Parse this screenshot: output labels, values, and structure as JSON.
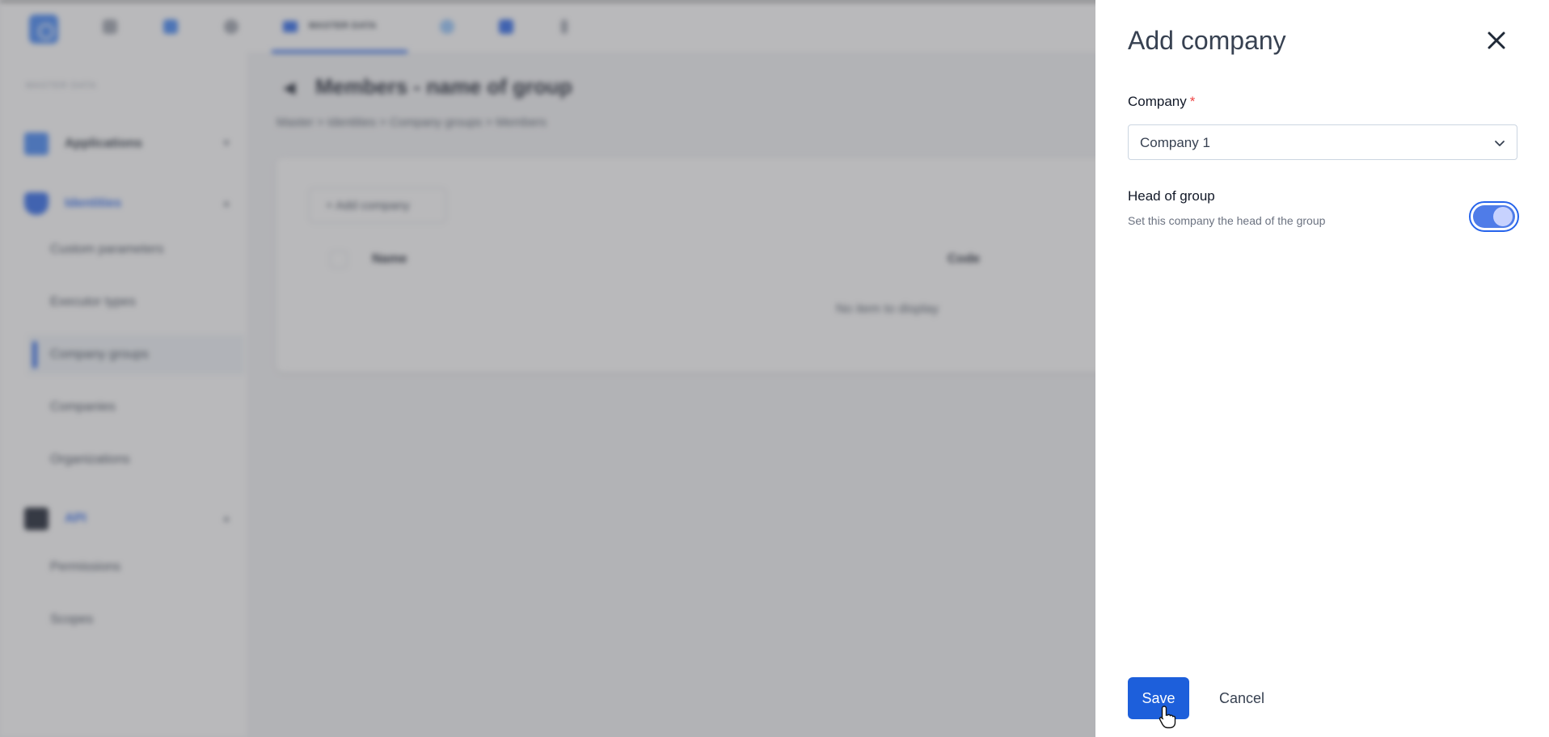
{
  "background": {
    "nav": {
      "active_tab_label": "MASTER DATA"
    },
    "sidebar": {
      "section_label": "MASTER DATA",
      "groups": [
        {
          "label": "Applications",
          "icon": "applications-icon"
        },
        {
          "label": "Identities",
          "icon": "shield-icon"
        },
        {
          "label": "API",
          "icon": "terminal-icon"
        }
      ],
      "items": [
        {
          "label": "Custom parameters"
        },
        {
          "label": "Executor types"
        },
        {
          "label": "Company groups"
        },
        {
          "label": "Companies"
        },
        {
          "label": "Organizations"
        },
        {
          "label": "Permissions"
        },
        {
          "label": "Scopes"
        }
      ]
    },
    "page_title": "Members - name of group",
    "breadcrumb": "Master  >  Identities  >  Company groups  >  Members",
    "add_button_label": "+ Add company",
    "table": {
      "columns": [
        "Name",
        "Code"
      ],
      "empty_text": "No item to display"
    }
  },
  "drawer": {
    "title": "Add company",
    "company_field": {
      "label": "Company",
      "required_mark": "*",
      "value": "Company 1"
    },
    "head_of_group": {
      "title": "Head of group",
      "description": "Set this company the head of the group",
      "enabled": true
    },
    "save_label": "Save",
    "cancel_label": "Cancel"
  },
  "colors": {
    "primary": "#1d5fdb",
    "required": "#ef4444",
    "overlay": "#646469"
  }
}
